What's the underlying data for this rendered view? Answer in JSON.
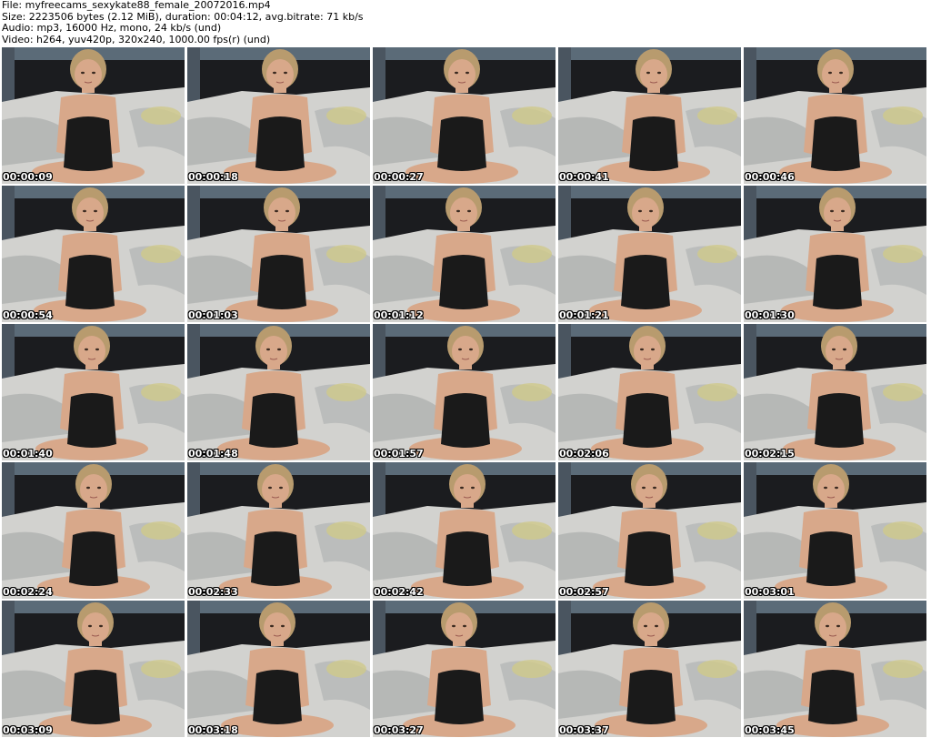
{
  "header": {
    "file_line": "File: myfreecams_sexykate88_female_20072016.mp4",
    "size_line": "Size: 2223506 bytes (2.12 MiB), duration: 00:04:12, avg.bitrate: 71 kb/s",
    "audio_line": "Audio: mp3, 16000 Hz, mono, 24 kb/s (und)",
    "video_line": "Video: h264, yuv420p, 320x240, 1000.00 fps(r) (und)"
  },
  "frames": [
    {
      "timestamp": "00:00:09"
    },
    {
      "timestamp": "00:00:18"
    },
    {
      "timestamp": "00:00:27"
    },
    {
      "timestamp": "00:00:41"
    },
    {
      "timestamp": "00:00:46"
    },
    {
      "timestamp": "00:00:54"
    },
    {
      "timestamp": "00:01:03"
    },
    {
      "timestamp": "00:01:12"
    },
    {
      "timestamp": "00:01:21"
    },
    {
      "timestamp": "00:01:30"
    },
    {
      "timestamp": "00:01:40"
    },
    {
      "timestamp": "00:01:48"
    },
    {
      "timestamp": "00:01:57"
    },
    {
      "timestamp": "00:02:06"
    },
    {
      "timestamp": "00:02:15"
    },
    {
      "timestamp": "00:02:24"
    },
    {
      "timestamp": "00:02:33"
    },
    {
      "timestamp": "00:02:42"
    },
    {
      "timestamp": "00:02:57"
    },
    {
      "timestamp": "00:03:01"
    },
    {
      "timestamp": "00:03:09"
    },
    {
      "timestamp": "00:03:18"
    },
    {
      "timestamp": "00:03:27"
    },
    {
      "timestamp": "00:03:37"
    },
    {
      "timestamp": "00:03:45"
    }
  ],
  "colors": {
    "wall": "#5b6b78",
    "headboard": "#1b1c1f",
    "bedding": "#d2d2cf",
    "bedding_shadow": "#9fa3a3",
    "pillow_accent": "#cfc98a",
    "skin": "#d8a88a",
    "hair": "#b89b6e",
    "garment": "#1a1a1a"
  }
}
